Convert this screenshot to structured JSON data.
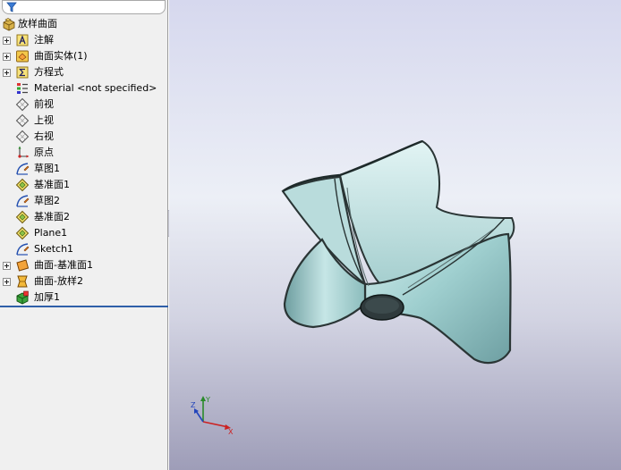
{
  "feature_tree": {
    "root_label": "放样曲面",
    "items": [
      {
        "label": "注解",
        "icon": "annotations-icon",
        "expandable": true
      },
      {
        "label": "曲面实体(1)",
        "icon": "surface-bodies-icon",
        "expandable": true
      },
      {
        "label": "方程式",
        "icon": "equations-icon",
        "expandable": true
      },
      {
        "label": "Material <not specified>",
        "icon": "material-icon",
        "expandable": false
      },
      {
        "label": "前视",
        "icon": "plane-icon",
        "expandable": false
      },
      {
        "label": "上视",
        "icon": "plane-icon",
        "expandable": false
      },
      {
        "label": "右视",
        "icon": "plane-icon",
        "expandable": false
      },
      {
        "label": "原点",
        "icon": "origin-icon",
        "expandable": false
      },
      {
        "label": "草图1",
        "icon": "sketch-icon",
        "expandable": false
      },
      {
        "label": "基准面1",
        "icon": "ref-plane-icon",
        "expandable": false
      },
      {
        "label": "草图2",
        "icon": "sketch-icon",
        "expandable": false
      },
      {
        "label": "基准面2",
        "icon": "ref-plane-icon",
        "expandable": false
      },
      {
        "label": "Plane1",
        "icon": "ref-plane-icon",
        "expandable": false
      },
      {
        "label": "Sketch1",
        "icon": "sketch-icon",
        "expandable": false
      },
      {
        "label": "曲面-基准面1",
        "icon": "planar-surface-icon",
        "expandable": true
      },
      {
        "label": "曲面-放样2",
        "icon": "loft-surface-icon",
        "expandable": true
      },
      {
        "label": "加厚1",
        "icon": "thicken-icon",
        "expandable": false
      }
    ]
  },
  "triad": {
    "x_label": "X",
    "y_label": "Y",
    "z_label": "Z"
  },
  "colors": {
    "model_fill": "#a9d3d3",
    "model_edge": "#2a3535",
    "viewport_top": "#d6d8ee",
    "viewport_bottom": "#9e9db8",
    "rollback_bar": "#2f5fa8"
  }
}
